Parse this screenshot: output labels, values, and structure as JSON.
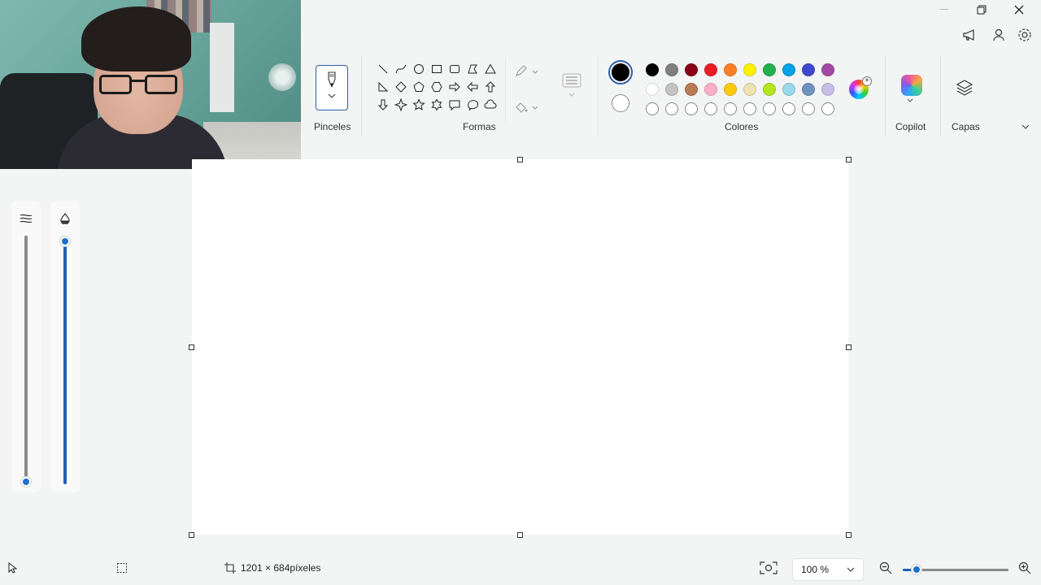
{
  "ribbon": {
    "brushes_label": "Pinceles",
    "shapes_label": "Formas",
    "colors_label": "Colores",
    "copilot_label": "Copilot",
    "layers_label": "Capas"
  },
  "colors": {
    "primary": "#000000",
    "secondary": "#ffffff",
    "palette": [
      "#000000",
      "#7f7f7f",
      "#880015",
      "#ed1c24",
      "#ff7f27",
      "#fff200",
      "#22b14c",
      "#00a2e8",
      "#3f48cc",
      "#a349a4",
      "#ffffff",
      "#c3c3c3",
      "#b97a57",
      "#ffaec9",
      "#ffc90e",
      "#efe4b0",
      "#b5e61d",
      "#99d9ea",
      "#7092be",
      "#c8bfe7",
      "",
      "",
      "",
      "",
      "",
      "",
      "",
      "",
      "",
      ""
    ]
  },
  "shapes": [
    "line-icon",
    "curve-icon",
    "oval-icon",
    "rectangle-icon",
    "rounded-rectangle-icon",
    "polygon-icon",
    "triangle-icon",
    "right-triangle-icon",
    "diamond-icon",
    "pentagon-icon",
    "hexagon-icon",
    "right-arrow-icon",
    "left-arrow-icon",
    "up-arrow-icon",
    "down-arrow-icon",
    "four-point-star-icon",
    "five-point-star-icon",
    "six-point-star-icon",
    "rect-callout-icon",
    "oval-callout-icon",
    "cloud-callout-icon"
  ],
  "sliders": {
    "size_level": 0.0,
    "opacity_level": 1.0
  },
  "status": {
    "canvas_size": "1201 × 684píxeles",
    "zoom": "100 %",
    "zoom_level": 0.13
  },
  "icons": {
    "pointer": "pointer-icon",
    "selection": "selection-icon",
    "canvas_size": "canvas-size-icon",
    "fit": "fit-to-window-icon",
    "zoom_out": "zoom-out-icon",
    "zoom_in": "zoom-in-icon"
  }
}
